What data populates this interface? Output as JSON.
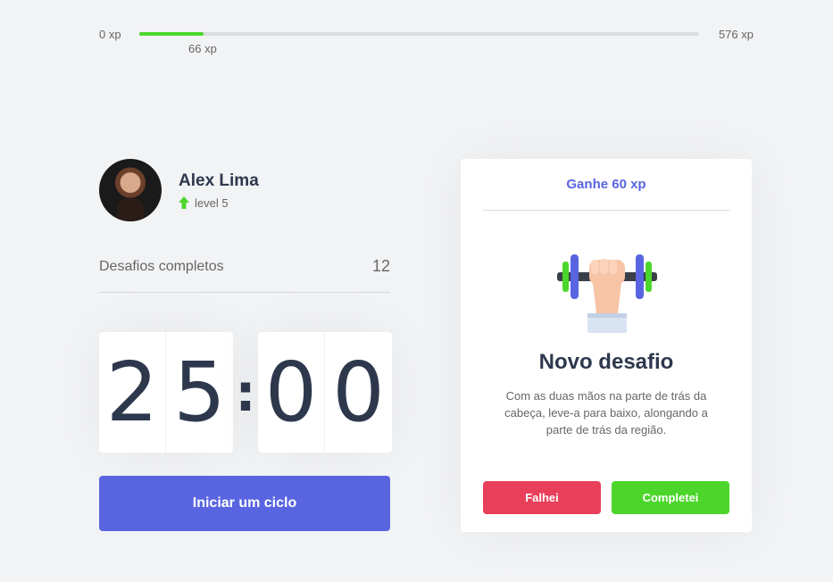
{
  "xp": {
    "min_label": "0 xp",
    "max_label": "576 xp",
    "current_label": "66 xp",
    "progress": 0.115,
    "fill_color": "#4cd62b"
  },
  "profile": {
    "name": "Alex Lima",
    "level": "level 5",
    "level_icon": "up-arrow-icon"
  },
  "challenges": {
    "label": "Desafios completos",
    "count": "12"
  },
  "countdown": {
    "minute_tens": "2",
    "minute_units": "5",
    "separator": ":",
    "second_tens": "0",
    "second_units": "0"
  },
  "start_button": {
    "label": "Iniciar um ciclo",
    "color": "#5965e0"
  },
  "challenge_card": {
    "header": "Ganhe 60 xp",
    "icon": "dumbbell-icon",
    "title": "Novo desafio",
    "description": "Com as duas mãos na parte de trás da cabeça, leve-a para baixo, alongando a parte de trás da região.",
    "fail_label": "Falhei",
    "done_label": "Completei",
    "fail_color": "#e83f5b",
    "done_color": "#4cd62b"
  }
}
